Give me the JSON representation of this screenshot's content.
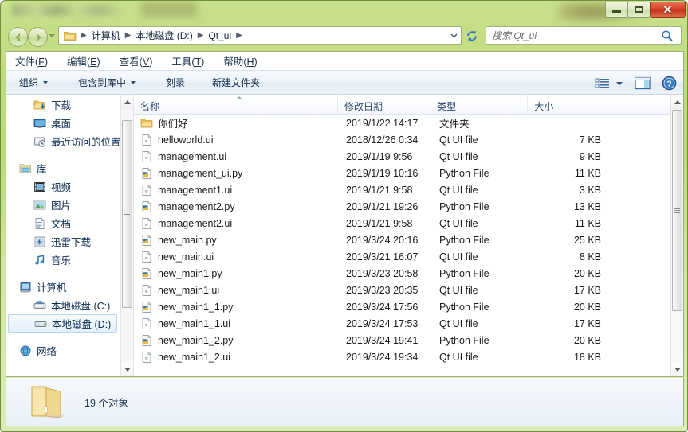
{
  "window": {
    "title": "",
    "buttons": {
      "minimize": "minimize-button",
      "maximize": "maximize-button",
      "close": "✕"
    }
  },
  "address": {
    "back_tooltip": "后退",
    "forward_tooltip": "前进",
    "crumbs": [
      "计算机",
      "本地磁盘 (D:)",
      "Qt_ui"
    ],
    "separator": "▶",
    "folder_icon": "folder-icon"
  },
  "search": {
    "placeholder": "搜索 Qt_ui",
    "value": "",
    "icon": "search-icon"
  },
  "menubar": {
    "items": [
      {
        "pre": "文件(",
        "key": "F",
        "post": ")"
      },
      {
        "pre": "编辑(",
        "key": "E",
        "post": ")"
      },
      {
        "pre": "查看(",
        "key": "V",
        "post": ")"
      },
      {
        "pre": "工具(",
        "key": "T",
        "post": ")"
      },
      {
        "pre": "帮助(",
        "key": "H",
        "post": ")"
      }
    ]
  },
  "toolbar": {
    "organize": "组织",
    "include_in_library": "包含到库中",
    "burn": "刻录",
    "new_folder": "新建文件夹",
    "view_icon": "list-view-icon",
    "view_caret": "chevron-down-icon",
    "preview_icon": "preview-pane-icon",
    "help_icon": "help-icon"
  },
  "sidebar": {
    "items": [
      {
        "label": "下载",
        "icon": "downloads-icon",
        "level": 2,
        "selected": false
      },
      {
        "label": "桌面",
        "icon": "desktop-icon",
        "level": 2,
        "selected": false
      },
      {
        "label": "最近访问的位置",
        "icon": "recent-places-icon",
        "level": 2,
        "selected": false
      },
      {
        "label": "库",
        "icon": "libraries-icon",
        "level": 1,
        "selected": false,
        "header": true
      },
      {
        "label": "视频",
        "icon": "videos-icon",
        "level": 2,
        "selected": false
      },
      {
        "label": "图片",
        "icon": "pictures-icon",
        "level": 2,
        "selected": false
      },
      {
        "label": "文档",
        "icon": "documents-icon",
        "level": 2,
        "selected": false
      },
      {
        "label": "迅雷下载",
        "icon": "thunder-download-icon",
        "level": 2,
        "selected": false
      },
      {
        "label": "音乐",
        "icon": "music-icon",
        "level": 2,
        "selected": false
      },
      {
        "label": "计算机",
        "icon": "computer-icon",
        "level": 1,
        "selected": false,
        "header": true
      },
      {
        "label": "本地磁盘 (C:)",
        "icon": "hard-drive-icon",
        "level": 2,
        "selected": false
      },
      {
        "label": "本地磁盘 (D:)",
        "icon": "drive-icon",
        "level": 2,
        "selected": true
      },
      {
        "label": "网络",
        "icon": "network-icon",
        "level": 1,
        "selected": false,
        "header": true
      }
    ]
  },
  "filelist": {
    "columns": [
      {
        "label": "名称",
        "key": "name",
        "sorted": true,
        "sort_dir": "asc"
      },
      {
        "label": "修改日期",
        "key": "date",
        "sorted": false
      },
      {
        "label": "类型",
        "key": "type",
        "sorted": false
      },
      {
        "label": "大小",
        "key": "size",
        "sorted": false
      }
    ],
    "rows": [
      {
        "name": "你们好",
        "date": "2019/1/22 14:17",
        "type": "文件夹",
        "size": "",
        "icon": "folder-icon"
      },
      {
        "name": "helloworld.ui",
        "date": "2018/12/26 0:34",
        "type": "Qt UI file",
        "size": "7 KB",
        "icon": "ui-file-icon"
      },
      {
        "name": "management.ui",
        "date": "2019/1/19 9:56",
        "type": "Qt UI file",
        "size": "9 KB",
        "icon": "ui-file-icon"
      },
      {
        "name": "management_ui.py",
        "date": "2019/1/19 10:16",
        "type": "Python File",
        "size": "11 KB",
        "icon": "python-file-icon"
      },
      {
        "name": "management1.ui",
        "date": "2019/1/21 9:58",
        "type": "Qt UI file",
        "size": "3 KB",
        "icon": "ui-file-icon"
      },
      {
        "name": "management2.py",
        "date": "2019/1/21 19:26",
        "type": "Python File",
        "size": "13 KB",
        "icon": "python-file-icon"
      },
      {
        "name": "management2.ui",
        "date": "2019/1/21 9:58",
        "type": "Qt UI file",
        "size": "11 KB",
        "icon": "ui-file-icon"
      },
      {
        "name": "new_main.py",
        "date": "2019/3/24 20:16",
        "type": "Python File",
        "size": "25 KB",
        "icon": "python-file-icon"
      },
      {
        "name": "new_main.ui",
        "date": "2019/3/21 16:07",
        "type": "Qt UI file",
        "size": "8 KB",
        "icon": "ui-file-icon"
      },
      {
        "name": "new_main1.py",
        "date": "2019/3/23 20:58",
        "type": "Python File",
        "size": "20 KB",
        "icon": "python-file-icon"
      },
      {
        "name": "new_main1.ui",
        "date": "2019/3/23 20:35",
        "type": "Qt UI file",
        "size": "17 KB",
        "icon": "ui-file-icon"
      },
      {
        "name": "new_main1_1.py",
        "date": "2019/3/24 17:56",
        "type": "Python File",
        "size": "20 KB",
        "icon": "python-file-icon"
      },
      {
        "name": "new_main1_1.ui",
        "date": "2019/3/24 17:53",
        "type": "Qt UI file",
        "size": "17 KB",
        "icon": "ui-file-icon"
      },
      {
        "name": "new_main1_2.py",
        "date": "2019/3/24 19:41",
        "type": "Python File",
        "size": "20 KB",
        "icon": "python-file-icon"
      },
      {
        "name": "new_main1_2.ui",
        "date": "2019/3/24 19:34",
        "type": "Qt UI file",
        "size": "18 KB",
        "icon": "ui-file-icon"
      }
    ]
  },
  "statusbar": {
    "item_count": "19 个对象",
    "icon": "folder-large-icon"
  },
  "colors": {
    "frame": "#b9d977",
    "close_button": "#d8452a",
    "selection": "#e4f0fb",
    "link_text": "#0c2c52"
  }
}
